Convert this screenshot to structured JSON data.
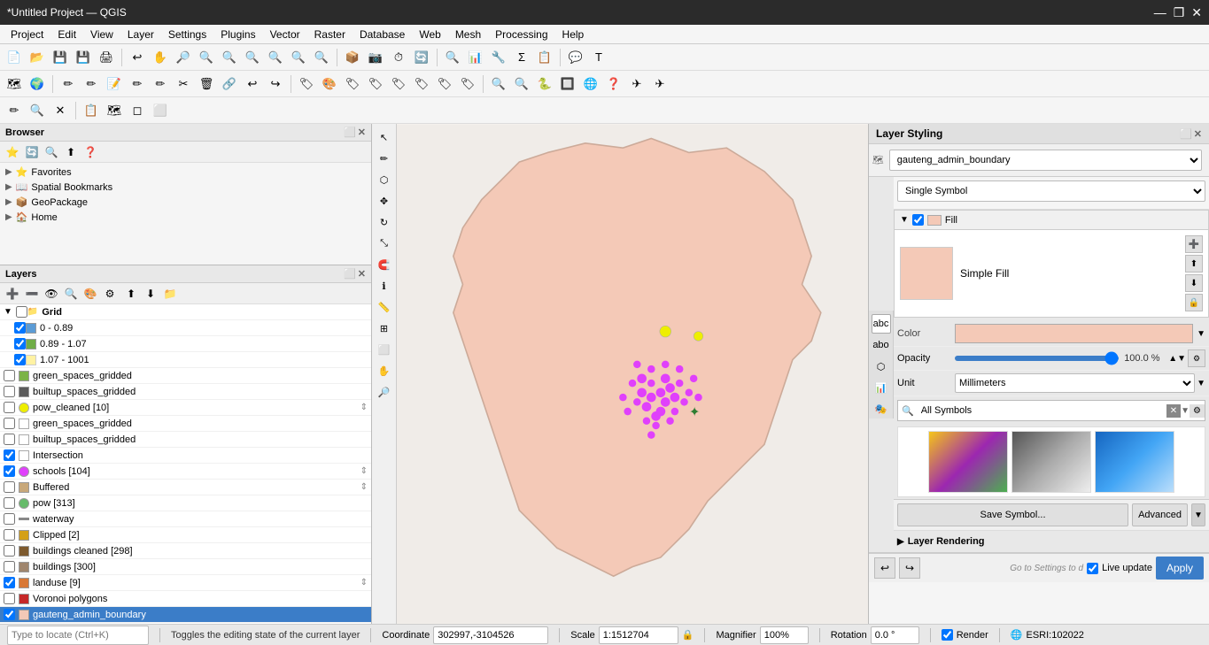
{
  "titleBar": {
    "title": "*Untitled Project — QGIS",
    "controls": [
      "—",
      "❐",
      "✕"
    ]
  },
  "menuBar": {
    "items": [
      "Project",
      "Edit",
      "View",
      "Layer",
      "Settings",
      "Plugins",
      "Vector",
      "Raster",
      "Database",
      "Web",
      "Mesh",
      "Processing",
      "Help"
    ]
  },
  "toolbar1": {
    "buttons": [
      "📄",
      "📂",
      "💾",
      "💾",
      "🖨",
      "🔍",
      "🖱",
      "✋",
      "➕",
      "🔎",
      "🔍",
      "🔍",
      "🔍",
      "🔍",
      "🔍",
      "🔍",
      "📦",
      "📷",
      "⏱",
      "🔄",
      "🔍",
      "📊",
      "📊",
      "🔧",
      "Σ",
      "📋",
      "💬",
      "T"
    ]
  },
  "toolbar2": {
    "buttons": [
      "🗺",
      "🌍",
      "✏",
      "✏",
      "📝",
      "✏",
      "✏",
      "✂",
      "🗑",
      "🔗",
      "↩",
      "↪",
      "🏷",
      "🎨",
      "🏷",
      "🏷",
      "🏷",
      "🏷",
      "🏷",
      "🏷",
      "🏷",
      "🔍",
      "🔍",
      "🐍",
      "🔲",
      "🌐",
      "❓",
      "✈",
      "✈"
    ]
  },
  "toolbar3": {
    "buttons": [
      "✏",
      "🔍",
      "✕",
      "📋",
      "🗺",
      "◻",
      "⬜"
    ]
  },
  "browser": {
    "title": "Browser",
    "items": [
      {
        "label": "Favorites",
        "icon": "⭐",
        "arrow": "▶"
      },
      {
        "label": "Spatial Bookmarks",
        "icon": "📖",
        "arrow": "▶"
      },
      {
        "label": "GeoPackage",
        "icon": "📦",
        "arrow": "▶"
      },
      {
        "label": "Home",
        "icon": "🏠",
        "arrow": "▶"
      }
    ]
  },
  "layers": {
    "title": "Layers",
    "items": [
      {
        "label": "Grid",
        "indent": 0,
        "checked": false,
        "type": "group",
        "expanded": true
      },
      {
        "label": "0 - 0.89",
        "indent": 1,
        "checked": true,
        "type": "ramp",
        "color": "#5b9bd5"
      },
      {
        "label": "0.89 - 1.07",
        "indent": 1,
        "checked": true,
        "type": "ramp",
        "color": "#70ad47"
      },
      {
        "label": "1.07 - 1001",
        "indent": 1,
        "checked": true,
        "type": "ramp",
        "color": "#fff2a3"
      },
      {
        "label": "green_spaces_gridded",
        "indent": 0,
        "checked": false,
        "type": "polygon",
        "color": "#7cb347"
      },
      {
        "label": "builtup_spaces_gridded",
        "indent": 0,
        "checked": false,
        "type": "polygon",
        "color": "#5a5a5a"
      },
      {
        "label": "pow_cleaned [10]",
        "indent": 0,
        "checked": false,
        "type": "point",
        "color": "#eeee00"
      },
      {
        "label": "green_spaces_gridded",
        "indent": 0,
        "checked": false,
        "type": "polygon",
        "color": "transparent"
      },
      {
        "label": "builtup_spaces_gridded",
        "indent": 0,
        "checked": false,
        "type": "polygon",
        "color": "transparent"
      },
      {
        "label": "Intersection",
        "indent": 0,
        "checked": true,
        "type": "polygon",
        "color": "transparent"
      },
      {
        "label": "schools [104]",
        "indent": 0,
        "checked": true,
        "type": "point",
        "color": "#e040fb"
      },
      {
        "label": "Buffered",
        "indent": 0,
        "checked": false,
        "type": "polygon",
        "color": "#c8a87a"
      },
      {
        "label": "pow [313]",
        "indent": 0,
        "checked": false,
        "type": "point",
        "color": "#66bb6a"
      },
      {
        "label": "waterway",
        "indent": 0,
        "checked": false,
        "type": "line",
        "color": "#888888"
      },
      {
        "label": "Clipped [2]",
        "indent": 0,
        "checked": false,
        "type": "polygon",
        "color": "#d4a017"
      },
      {
        "label": "buildings cleaned [298]",
        "indent": 0,
        "checked": false,
        "type": "polygon",
        "color": "#7d5a2e"
      },
      {
        "label": "buildings [300]",
        "indent": 0,
        "checked": false,
        "type": "polygon",
        "color": "#a0866e"
      },
      {
        "label": "landuse [9]",
        "indent": 0,
        "checked": true,
        "type": "polygon",
        "color": "#d87836"
      },
      {
        "label": "Voronoi polygons",
        "indent": 0,
        "checked": false,
        "type": "polygon",
        "color": "#c62828"
      },
      {
        "label": "gauteng_admin_boundary",
        "indent": 0,
        "checked": true,
        "type": "polygon",
        "color": "#f4c9b7",
        "selected": true
      }
    ]
  },
  "styling": {
    "title": "Layer Styling",
    "layerName": "gauteng_admin_boundary",
    "renderer": "Single Symbol",
    "fill": {
      "label": "Fill",
      "subLabel": "Simple Fill",
      "color": "#f4c9b7"
    },
    "color": {
      "label": "Color",
      "value": "#f4c9b7"
    },
    "opacity": {
      "label": "Opacity",
      "value": "100.0 %",
      "percent": 100
    },
    "unit": {
      "label": "Unit",
      "value": "Millimeters"
    },
    "symbols": {
      "searchPlaceholder": "All Symbols",
      "items": [
        {
          "type": "grad1"
        },
        {
          "type": "grad2"
        },
        {
          "type": "grad3"
        }
      ]
    },
    "saveLabel": "Save Symbol...",
    "advancedLabel": "Advanced",
    "layerRendering": "Layer Rendering",
    "applyLabel": "Apply",
    "liveUpdate": "Live update"
  },
  "statusBar": {
    "searchPlaceholder": "Type to locate (Ctrl+K)",
    "tooltip": "Toggles the editing state of the current layer",
    "coordinate": "302997,-3104526",
    "coordinateLabel": "Coordinate",
    "scaleLabel": "Scale",
    "scale": "1:1512704",
    "magnifierLabel": "Magnifier",
    "magnifier": "100%",
    "rotationLabel": "Rotation",
    "rotation": "0.0 °",
    "renderLabel": "Render",
    "crsLabel": "ESRI:102022"
  }
}
